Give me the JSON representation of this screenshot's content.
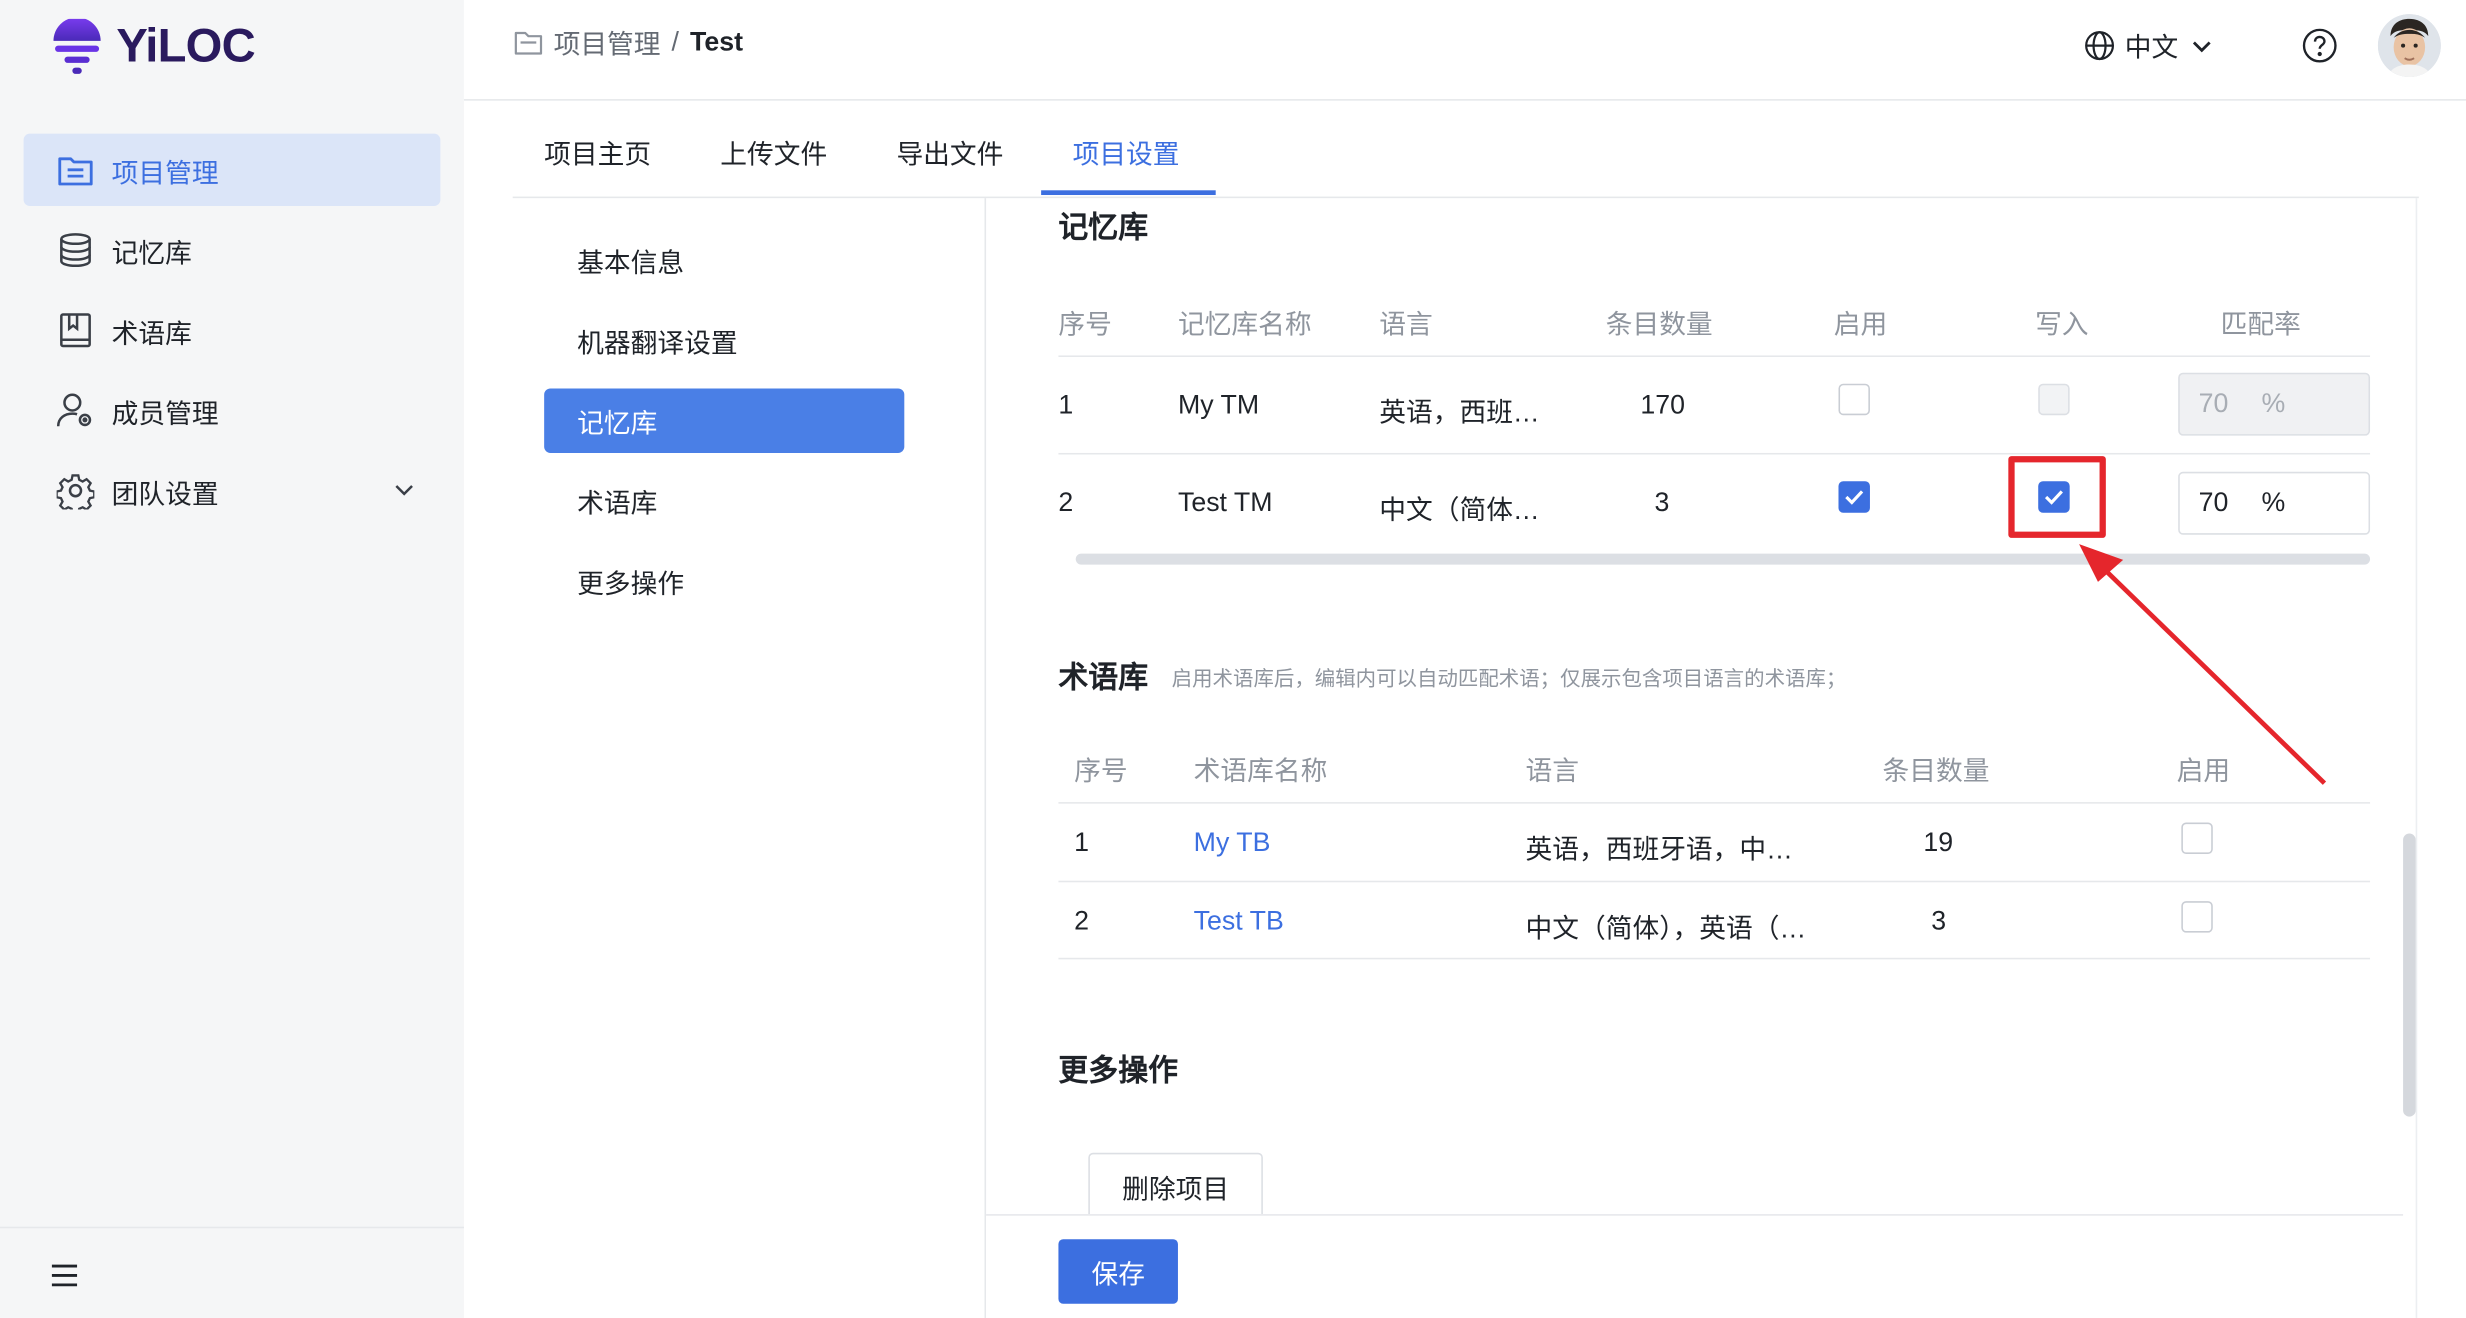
{
  "app": {
    "logo_text": "YiLOC"
  },
  "sidebar": {
    "items": [
      {
        "label": "项目管理",
        "icon": "project-list-icon",
        "active": true
      },
      {
        "label": "记忆库",
        "icon": "database-icon"
      },
      {
        "label": "术语库",
        "icon": "book-icon"
      },
      {
        "label": "成员管理",
        "icon": "member-settings-icon"
      },
      {
        "label": "团队设置",
        "icon": "gear-icon",
        "has_children": true
      }
    ],
    "footer_icon": "menu-icon"
  },
  "header": {
    "breadcrumb": {
      "parent": "项目管理",
      "separator": "/",
      "current": "Test"
    },
    "language": "中文",
    "help_icon": "question-icon"
  },
  "tabs": [
    {
      "label": "项目主页"
    },
    {
      "label": "上传文件"
    },
    {
      "label": "导出文件"
    },
    {
      "label": "项目设置",
      "active": true
    }
  ],
  "settings_nav": [
    {
      "label": "基本信息"
    },
    {
      "label": "机器翻译设置"
    },
    {
      "label": "记忆库",
      "active": true
    },
    {
      "label": "术语库"
    },
    {
      "label": "更多操作"
    }
  ],
  "tm": {
    "title": "记忆库",
    "columns": [
      "序号",
      "记忆库名称",
      "语言",
      "条目数量",
      "启用",
      "写入",
      "匹配率"
    ],
    "rows": [
      {
        "index": "1",
        "name": "My TM",
        "language": "英语，西班…",
        "count": "170",
        "enabled": false,
        "write": false,
        "write_disabled": true,
        "rate": "70",
        "rate_unit": "%",
        "rate_disabled": true
      },
      {
        "index": "2",
        "name": "Test TM",
        "language": "中文（简体…",
        "count": "3",
        "enabled": true,
        "write": true,
        "write_disabled": false,
        "rate": "70",
        "rate_unit": "%",
        "rate_disabled": false
      }
    ]
  },
  "tb": {
    "title": "术语库",
    "hint": "启用术语库后，编辑内可以自动匹配术语；仅展示包含项目语言的术语库；",
    "columns": [
      "序号",
      "术语库名称",
      "语言",
      "条目数量",
      "启用"
    ],
    "rows": [
      {
        "index": "1",
        "name": "My TB",
        "language": "英语，西班牙语，中…",
        "count": "19",
        "enabled": false
      },
      {
        "index": "2",
        "name": "Test TB",
        "language": "中文（简体），英语（…",
        "count": "3",
        "enabled": false
      }
    ]
  },
  "more": {
    "title": "更多操作",
    "delete_label": "删除项目"
  },
  "footer": {
    "save_label": "保存"
  },
  "colors": {
    "accent": "#3c6fe0",
    "annotation": "#e5262c",
    "sidebar_bg": "#f5f6f7"
  }
}
